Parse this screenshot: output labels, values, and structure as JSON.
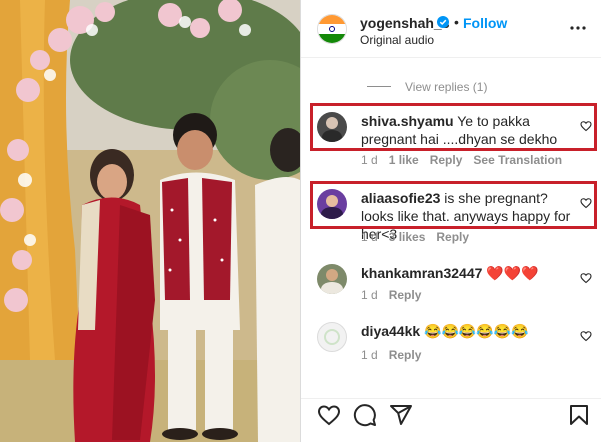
{
  "post": {
    "username": "yogenshah_s",
    "separator": "•",
    "follow_label": "Follow",
    "audio": "Original audio"
  },
  "view_replies": "View replies (1)",
  "comments": [
    {
      "username": "shiva.shyamu",
      "text": "Ye to pakka pregnant hai ....dhyan se dekho",
      "time": "1 d",
      "likes": "1 like",
      "reply": "Reply",
      "translation": "See Translation",
      "highlighted": true
    },
    {
      "username": "aliaasofie23",
      "text": "is she pregnant? looks like that. anyways happy for her<3",
      "time": "1 d",
      "likes": "3 likes",
      "reply": "Reply",
      "highlighted": true
    },
    {
      "username": "khankamran32447",
      "text": "❤️❤️❤️",
      "time": "1 d",
      "reply": "Reply"
    },
    {
      "username": "diya44kk",
      "text": "😂😂😂😂😂😂",
      "time": "1 d",
      "reply": "Reply"
    }
  ],
  "colors": {
    "follow": "#0095f6",
    "highlight": "#c8202a",
    "muted": "#8e8e8e",
    "text": "#262626"
  },
  "icons": [
    "verified-badge-icon",
    "more-options-icon",
    "heart-icon",
    "comment-icon",
    "share-icon",
    "save-icon"
  ]
}
